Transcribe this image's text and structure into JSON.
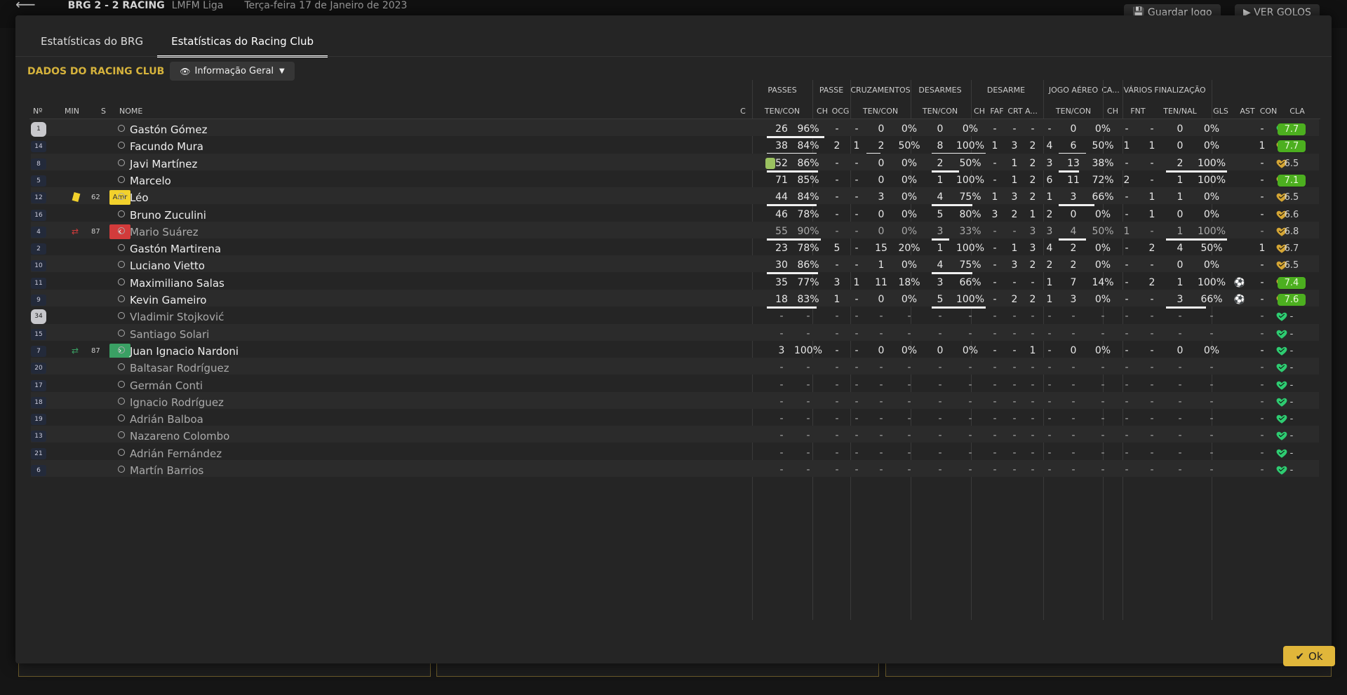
{
  "background": {
    "match_score": "BRG  2 - 2  RACING",
    "competition": "LMFM Liga",
    "date": "Terça-feira 17 de Janeiro de 2023",
    "save_label": "Guardar Jogo",
    "goals_label": "VER GOLOS"
  },
  "tabs": [
    {
      "label": "Estatísticas do BRG",
      "active": false
    },
    {
      "label": "Estatísticas do Racing Club",
      "active": true
    }
  ],
  "section": {
    "title": "DADOS DO RACING CLUB",
    "view": "Informação Geral"
  },
  "group_headers": {
    "passes": "PASSES",
    "passe": "PASSE",
    "cruzamentos": "CRUZAMENTOS",
    "desarmes": "DESARMES",
    "desarme": "DESARME",
    "jogo_aereo": "JOGO AÉREO",
    "ca": "CA...",
    "varios": "VÁRIOS",
    "finalizacao": "FINALIZAÇÃO"
  },
  "col_headers": {
    "no": "Nº",
    "min": "MIN",
    "s": "S",
    "nome": "NOME",
    "c": "C",
    "pass_tc": "TEN/CON",
    "ch1": "CH",
    "ocg": "OCG",
    "cruz_tc": "TEN/CON",
    "des_tc": "TEN/CON",
    "ch2": "CH",
    "faf": "FAF",
    "crt": "CRT",
    "a": "A...",
    "aer_tc": "TEN/CON",
    "ch3": "CH",
    "fnt": "FNT",
    "fin_tn": "TEN/NAL",
    "gls": "GLS",
    "ast": "AST",
    "con": "CON",
    "cla": "CLA"
  },
  "players": [
    {
      "no": "1",
      "shirt": true,
      "name": "Gastón Gómez",
      "pass": [
        "26",
        "96%"
      ],
      "pass_fill": 0.96,
      "ch": "-",
      "ocg": "-",
      "cruz": [
        "0",
        "0%"
      ],
      "cruz_fill": 0,
      "des": [
        "0",
        "0%"
      ],
      "des_fill": 0,
      "d": [
        "-",
        "-",
        "-",
        "-"
      ],
      "aer": [
        "0",
        "0%"
      ],
      "aer_fill": 0,
      "ca": "-",
      "fnt": "-",
      "fin": [
        "0",
        "0%"
      ],
      "fin_fill": 0,
      "gls": "",
      "ast": "-",
      "con": "green",
      "cla": "7.7",
      "cla_hi": true
    },
    {
      "no": "14",
      "name": "Facundo Mura",
      "pass": [
        "38",
        "84%"
      ],
      "pass_fill": 0.84,
      "ch": "2",
      "ocg": "1",
      "cruz": [
        "2",
        "50%"
      ],
      "cruz_fill": 0.5,
      "des": [
        "8",
        "100%"
      ],
      "des_fill": 1,
      "d": [
        "1",
        "3",
        "2",
        "4"
      ],
      "aer": [
        "6",
        "50%"
      ],
      "aer_fill": 0.5,
      "ca": "1",
      "fnt": "1",
      "fin": [
        "0",
        "0%"
      ],
      "fin_fill": 0,
      "gls": "",
      "ast": "1",
      "con": "gold",
      "cla": "7.7",
      "cla_hi": true
    },
    {
      "no": "8",
      "name": "Javi Martínez",
      "bottle": true,
      "pass": [
        "52",
        "86%"
      ],
      "pass_fill": 0.86,
      "ch": "-",
      "ocg": "-",
      "cruz": [
        "0",
        "0%"
      ],
      "cruz_fill": 0,
      "des": [
        "2",
        "50%"
      ],
      "des_fill": 0.5,
      "d": [
        "-",
        "1",
        "2",
        "3"
      ],
      "aer": [
        "13",
        "38%"
      ],
      "aer_fill": 0.38,
      "ca": "-",
      "fnt": "-",
      "fin": [
        "2",
        "100%"
      ],
      "fin_fill": 1,
      "gls": "",
      "ast": "-",
      "con": "gold",
      "cla": "6.5",
      "cla_hi": false
    },
    {
      "no": "5",
      "name": "Marcelo",
      "pass": [
        "71",
        "85%"
      ],
      "pass_fill": 0.85,
      "ch": "-",
      "ocg": "-",
      "cruz": [
        "0",
        "0%"
      ],
      "cruz_fill": 0,
      "des": [
        "1",
        "100%"
      ],
      "des_fill": 1,
      "d": [
        "-",
        "1",
        "2",
        "6"
      ],
      "aer": [
        "11",
        "72%"
      ],
      "aer_fill": 0.72,
      "ca": "2",
      "fnt": "-",
      "fin": [
        "1",
        "100%"
      ],
      "fin_fill": 1,
      "gls": "",
      "ast": "-",
      "con": "gold",
      "cla": "7.1",
      "cla_hi": true
    },
    {
      "no": "12",
      "min": "62",
      "card": "yellow",
      "badge": "Amr",
      "name": "Léo",
      "pass": [
        "44",
        "84%"
      ],
      "pass_fill": 0.84,
      "ch": "-",
      "ocg": "-",
      "cruz": [
        "3",
        "0%"
      ],
      "cruz_fill": 0,
      "des": [
        "4",
        "75%"
      ],
      "des_fill": 0.75,
      "d": [
        "1",
        "3",
        "2",
        "1"
      ],
      "aer": [
        "3",
        "66%"
      ],
      "aer_fill": 0.66,
      "ca": "-",
      "fnt": "1",
      "fin": [
        "1",
        "0%"
      ],
      "fin_fill": 0,
      "gls": "",
      "ast": "-",
      "con": "gold",
      "cla": "6.5",
      "cla_hi": false
    },
    {
      "no": "16",
      "name": "Bruno Zuculini",
      "pass": [
        "46",
        "78%"
      ],
      "pass_fill": 0.78,
      "ch": "-",
      "ocg": "-",
      "cruz": [
        "0",
        "0%"
      ],
      "cruz_fill": 0,
      "des": [
        "5",
        "80%"
      ],
      "des_fill": 0.8,
      "d": [
        "3",
        "2",
        "1",
        "2"
      ],
      "aer": [
        "0",
        "0%"
      ],
      "aer_fill": 0,
      "ca": "-",
      "fnt": "1",
      "fin": [
        "0",
        "0%"
      ],
      "fin_fill": 0,
      "gls": "",
      "ast": "-",
      "con": "gold",
      "cla": "6.6",
      "cla_hi": false
    },
    {
      "no": "4",
      "min": "87",
      "sub": "out",
      "dim": true,
      "name": "Mario Suárez",
      "pass": [
        "55",
        "90%"
      ],
      "pass_fill": 0.9,
      "ch": "-",
      "ocg": "-",
      "cruz": [
        "0",
        "0%"
      ],
      "cruz_fill": 0,
      "des": [
        "3",
        "33%"
      ],
      "des_fill": 0.33,
      "d": [
        "-",
        "-",
        "3",
        "3"
      ],
      "aer": [
        "4",
        "50%"
      ],
      "aer_fill": 0.5,
      "ca": "1",
      "fnt": "-",
      "fin": [
        "1",
        "100%"
      ],
      "fin_fill": 1,
      "gls": "",
      "ast": "-",
      "con": "gold",
      "cla": "6.8",
      "cla_hi": false
    },
    {
      "no": "2",
      "name": "Gastón Martirena",
      "pass": [
        "23",
        "78%"
      ],
      "pass_fill": 0.78,
      "ch": "5",
      "ocg": "-",
      "cruz": [
        "15",
        "20%"
      ],
      "cruz_fill": 0.2,
      "des": [
        "1",
        "100%"
      ],
      "des_fill": 1,
      "d": [
        "-",
        "1",
        "3",
        "4"
      ],
      "aer": [
        "2",
        "0%"
      ],
      "aer_fill": 0,
      "ca": "-",
      "fnt": "2",
      "fin": [
        "4",
        "50%"
      ],
      "fin_fill": 0.5,
      "gls": "",
      "ast": "1",
      "con": "gold",
      "cla": "6.7",
      "cla_hi": false
    },
    {
      "no": "10",
      "name": "Luciano Vietto",
      "pass": [
        "30",
        "86%"
      ],
      "pass_fill": 0.86,
      "ch": "-",
      "ocg": "-",
      "cruz": [
        "1",
        "0%"
      ],
      "cruz_fill": 0,
      "des": [
        "4",
        "75%"
      ],
      "des_fill": 0.75,
      "d": [
        "-",
        "3",
        "2",
        "2"
      ],
      "aer": [
        "2",
        "0%"
      ],
      "aer_fill": 0,
      "ca": "-",
      "fnt": "-",
      "fin": [
        "0",
        "0%"
      ],
      "fin_fill": 0,
      "gls": "",
      "ast": "-",
      "con": "gold",
      "cla": "6.5",
      "cla_hi": false
    },
    {
      "no": "11",
      "name": "Maximiliano Salas",
      "pass": [
        "35",
        "77%"
      ],
      "pass_fill": 0.77,
      "ch": "3",
      "ocg": "1",
      "cruz": [
        "11",
        "18%"
      ],
      "cruz_fill": 0.18,
      "des": [
        "3",
        "66%"
      ],
      "des_fill": 0.66,
      "d": [
        "-",
        "-",
        "-",
        "1"
      ],
      "aer": [
        "7",
        "14%"
      ],
      "aer_fill": 0.14,
      "ca": "-",
      "fnt": "2",
      "fin": [
        "1",
        "100%"
      ],
      "fin_fill": 1,
      "gls": "ball",
      "ast": "-",
      "con": "gold",
      "cla": "7.4",
      "cla_hi": true
    },
    {
      "no": "9",
      "name": "Kevin Gameiro",
      "pass": [
        "18",
        "83%"
      ],
      "pass_fill": 0.83,
      "ch": "1",
      "ocg": "-",
      "cruz": [
        "0",
        "0%"
      ],
      "cruz_fill": 0,
      "des": [
        "5",
        "100%"
      ],
      "des_fill": 1,
      "d": [
        "-",
        "2",
        "2",
        "1"
      ],
      "aer": [
        "3",
        "0%"
      ],
      "aer_fill": 0,
      "ca": "-",
      "fnt": "-",
      "fin": [
        "3",
        "66%"
      ],
      "fin_fill": 0.66,
      "gls": "ball",
      "ast": "-",
      "con": "gold",
      "cla": "7.6",
      "cla_hi": true
    },
    {
      "no": "34",
      "shirt": true,
      "dim": true,
      "name": "Vladimir Stojković",
      "empty": true
    },
    {
      "no": "15",
      "dim": true,
      "name": "Santiago Solari",
      "empty": true
    },
    {
      "no": "7",
      "min": "87",
      "sub": "in",
      "name": "Juan Ignacio Nardoni",
      "pass": [
        "3",
        "100%"
      ],
      "pass_fill": 1,
      "ch": "-",
      "ocg": "-",
      "cruz": [
        "0",
        "0%"
      ],
      "cruz_fill": 0,
      "des": [
        "0",
        "0%"
      ],
      "des_fill": 0,
      "d": [
        "-",
        "-",
        "1",
        "-"
      ],
      "aer": [
        "0",
        "0%"
      ],
      "aer_fill": 0,
      "ca": "-",
      "fnt": "-",
      "fin": [
        "0",
        "0%"
      ],
      "fin_fill": 0,
      "gls": "",
      "ast": "-",
      "con": "green",
      "cla": "-",
      "cla_hi": false
    },
    {
      "no": "20",
      "dim": true,
      "name": "Baltasar Rodríguez",
      "empty": true
    },
    {
      "no": "17",
      "dim": true,
      "name": "Germán Conti",
      "empty": true
    },
    {
      "no": "18",
      "dim": true,
      "name": "Ignacio Rodríguez",
      "empty": true
    },
    {
      "no": "19",
      "dim": true,
      "name": "Adrián Balboa",
      "empty": true
    },
    {
      "no": "13",
      "dim": true,
      "name": "Nazareno Colombo",
      "empty": true
    },
    {
      "no": "21",
      "dim": true,
      "name": "Adrián Fernández",
      "empty": true
    },
    {
      "no": "6",
      "dim": true,
      "name": "Martín Barrios",
      "empty": true
    }
  ],
  "ok_label": "Ok",
  "colors": {
    "accent": "#e0b63a",
    "title": "#d6b33c",
    "rating_hi": "#4caf1f",
    "heart_green": "#2ecc71",
    "heart_gold": "#d4a534"
  }
}
